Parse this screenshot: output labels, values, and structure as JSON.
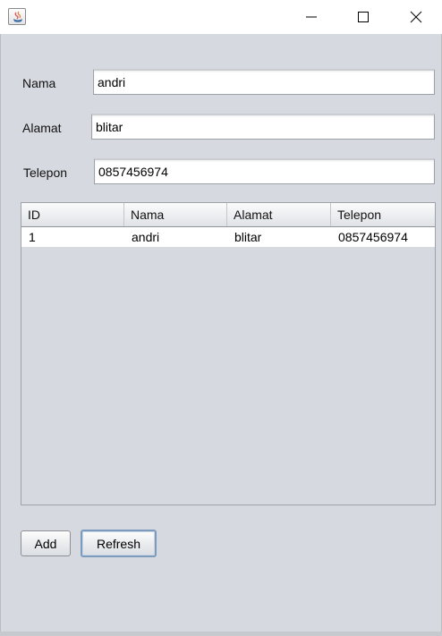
{
  "window": {
    "title": "",
    "controls": {
      "minimize": "minimize",
      "maximize": "maximize",
      "close": "close"
    }
  },
  "form": {
    "nama": {
      "label": "Nama",
      "value": "andri"
    },
    "alamat": {
      "label": "Alamat",
      "value": "blitar"
    },
    "telepon": {
      "label": "Telepon",
      "value": "0857456974"
    }
  },
  "table": {
    "columns": [
      "ID",
      "Nama",
      "Alamat",
      "Telepon"
    ],
    "rows": [
      [
        "1",
        "andri",
        "blitar",
        "0857456974"
      ]
    ]
  },
  "buttons": {
    "add": "Add",
    "refresh": "Refresh"
  },
  "colors": {
    "background": "#d6d9df",
    "focus_border": "#7d9bbd"
  }
}
